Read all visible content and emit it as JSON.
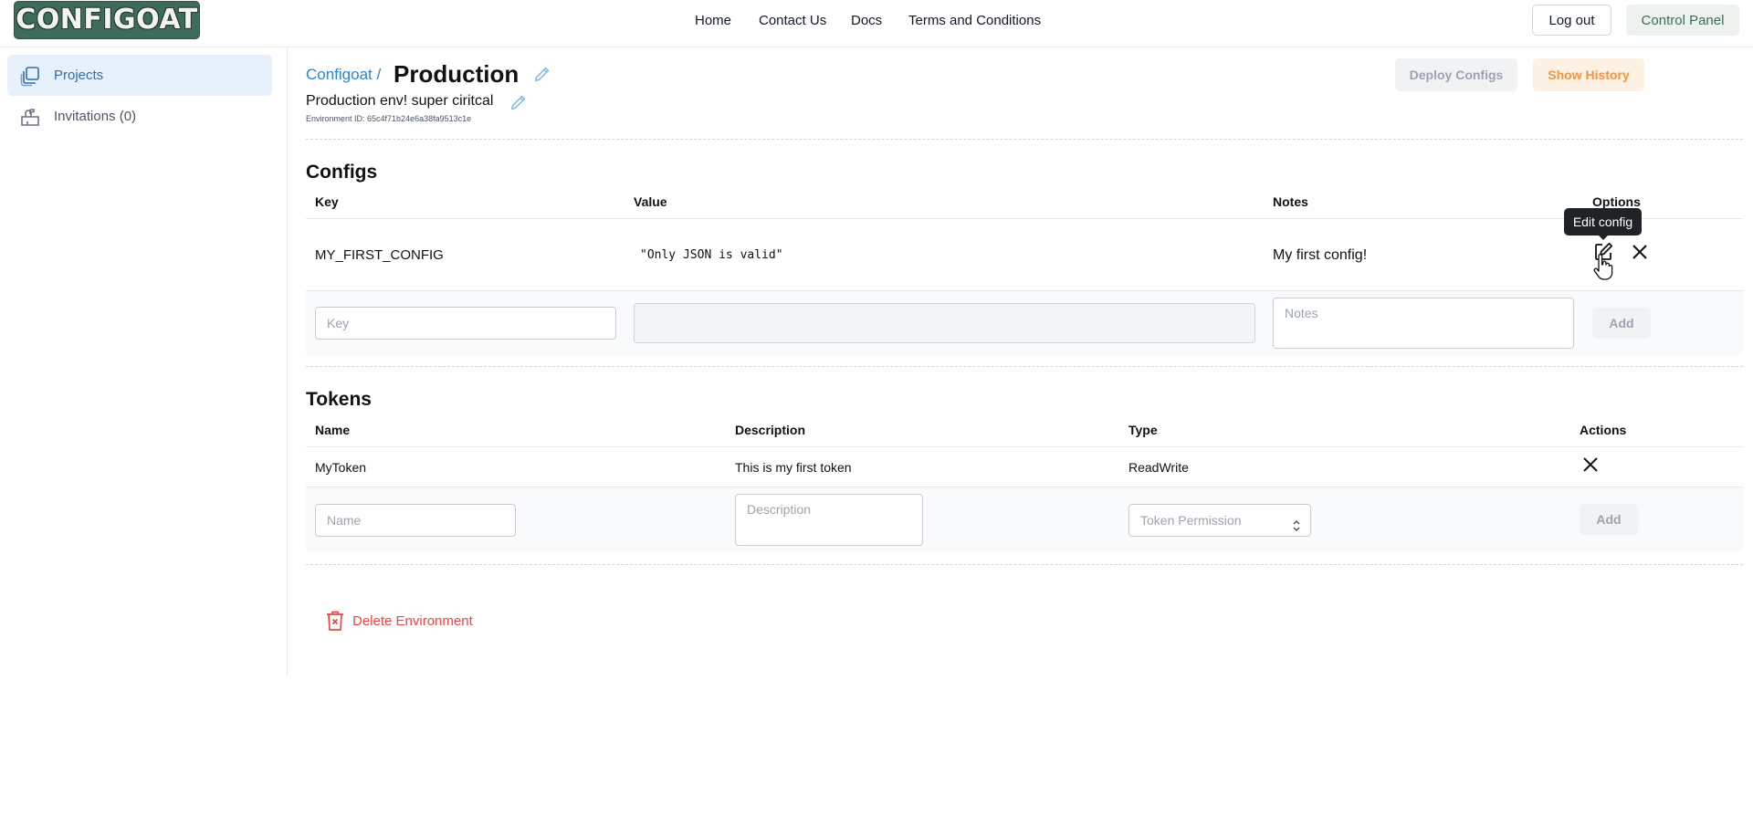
{
  "header": {
    "logo_text": "CONFIGOAT",
    "nav": [
      "Home",
      "Contact Us",
      "Docs",
      "Terms and Conditions"
    ],
    "logout_label": "Log out",
    "control_panel_label": "Control Panel"
  },
  "sidebar": {
    "items": [
      {
        "label": "Projects",
        "icon": "stacked-squares-icon",
        "active": true
      },
      {
        "label": "Invitations (0)",
        "icon": "mailbox-icon",
        "active": false
      }
    ]
  },
  "environment": {
    "breadcrumb": "Configoat /",
    "title": "Production",
    "description": "Production env! super ciritcal",
    "id_text": "Environment ID: 65c4f71b24e6a38fa9513c1e",
    "deploy_label": "Deploy Configs",
    "history_label": "Show History"
  },
  "configs": {
    "title": "Configs",
    "headers": {
      "key": "Key",
      "value": "Value",
      "notes": "Notes",
      "options": "Options"
    },
    "rows": [
      {
        "key": "MY_FIRST_CONFIG",
        "value": "\"Only JSON is valid\"",
        "notes": "My first config!"
      }
    ],
    "new_row": {
      "key_placeholder": "Key",
      "notes_placeholder": "Notes",
      "add_label": "Add"
    },
    "tooltip": "Edit config"
  },
  "tokens": {
    "title": "Tokens",
    "headers": {
      "name": "Name",
      "description": "Description",
      "type": "Type",
      "actions": "Actions"
    },
    "rows": [
      {
        "name": "MyToken",
        "description": "This is my first token",
        "type": "ReadWrite"
      }
    ],
    "new_row": {
      "name_placeholder": "Name",
      "description_placeholder": "Description",
      "permission_placeholder": "Token Permission",
      "add_label": "Add"
    }
  },
  "danger": {
    "delete_label": "Delete Environment"
  },
  "colors": {
    "accent": "#2e86c8",
    "brand": "#3f6b5b",
    "warning": "#ef9547",
    "danger": "#ef4444"
  }
}
